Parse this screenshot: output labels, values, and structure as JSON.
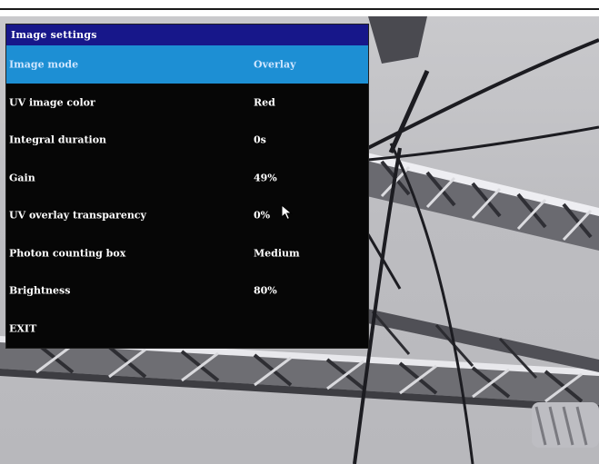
{
  "panel": {
    "title": "Image settings"
  },
  "menu": {
    "items": [
      {
        "label": "Image mode",
        "value": "Overlay"
      },
      {
        "label": "UV image color",
        "value": "Red"
      },
      {
        "label": "Integral duration",
        "value": "0s"
      },
      {
        "label": "Gain",
        "value": "49%"
      },
      {
        "label": "UV overlay transparency",
        "value": "0%"
      },
      {
        "label": "Photon counting box",
        "value": "Medium"
      },
      {
        "label": "Brightness",
        "value": "80%"
      },
      {
        "label": "EXIT",
        "value": ""
      }
    ],
    "selected_index": 0
  },
  "colors": {
    "title_bar": "#17178a",
    "selected_row": "#1d8fd4",
    "panel_background": "#060606",
    "sky": "#c4c4c8"
  },
  "icons": {
    "cursor": "mouse-pointer-icon"
  }
}
